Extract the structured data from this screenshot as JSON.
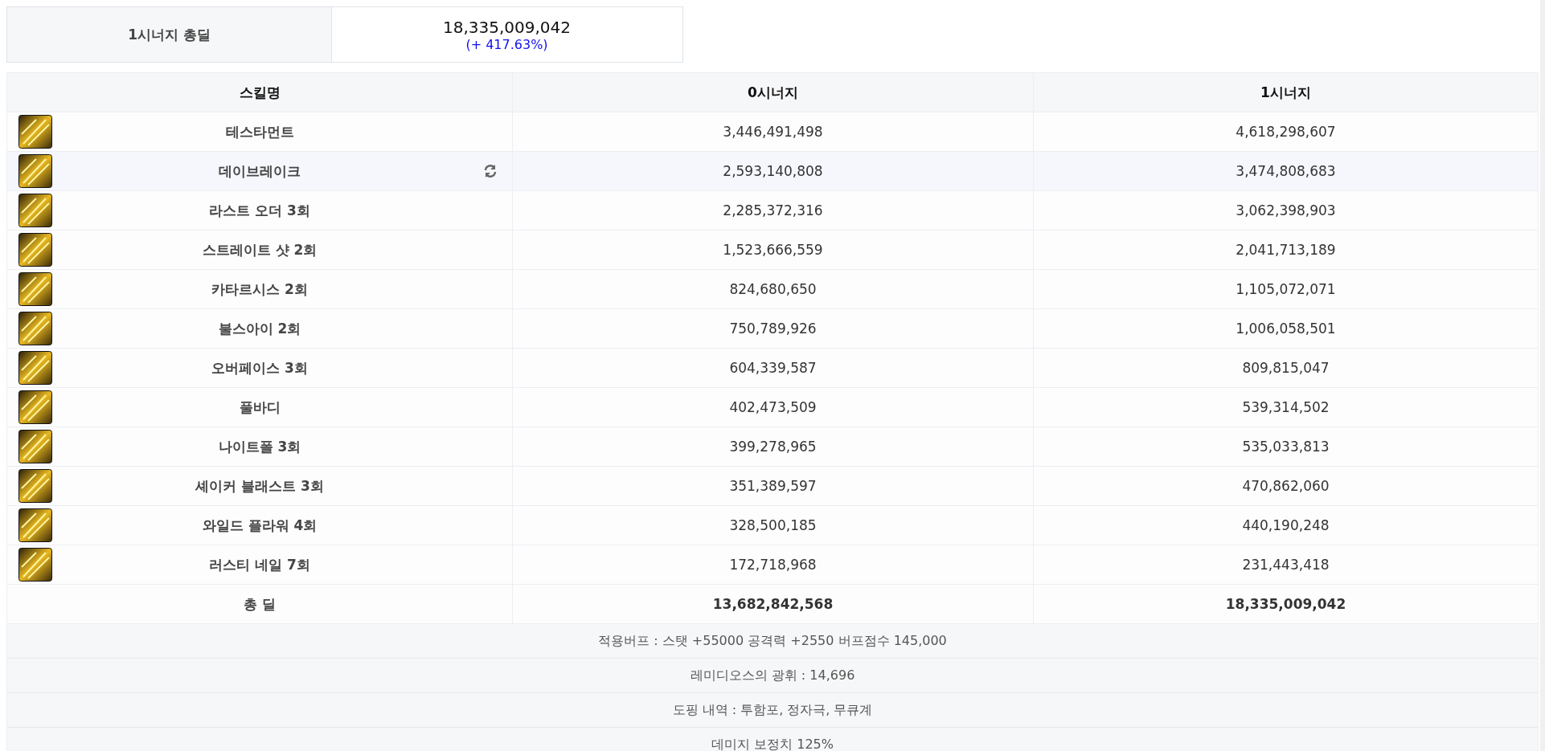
{
  "summary": {
    "label": "1시너지 총딜",
    "value": "18,335,009,042",
    "change": "(+ 417.63%)"
  },
  "table": {
    "columns": [
      "스킬명",
      "0시너지",
      "1시너지"
    ],
    "rows": [
      {
        "skill": "테스타먼트",
        "v0": "3,446,491,498",
        "v1": "4,618,298,607",
        "hovered": false
      },
      {
        "skill": "데이브레이크",
        "v0": "2,593,140,808",
        "v1": "3,474,808,683",
        "hovered": true
      },
      {
        "skill": "라스트 오더 3회",
        "v0": "2,285,372,316",
        "v1": "3,062,398,903",
        "hovered": false
      },
      {
        "skill": "스트레이트 샷 2회",
        "v0": "1,523,666,559",
        "v1": "2,041,713,189",
        "hovered": false
      },
      {
        "skill": "카타르시스 2회",
        "v0": "824,680,650",
        "v1": "1,105,072,071",
        "hovered": false
      },
      {
        "skill": "불스아이 2회",
        "v0": "750,789,926",
        "v1": "1,006,058,501",
        "hovered": false
      },
      {
        "skill": "오버페이스 3회",
        "v0": "604,339,587",
        "v1": "809,815,047",
        "hovered": false
      },
      {
        "skill": "풀바디",
        "v0": "402,473,509",
        "v1": "539,314,502",
        "hovered": false
      },
      {
        "skill": "나이트폴 3회",
        "v0": "399,278,965",
        "v1": "535,033,813",
        "hovered": false
      },
      {
        "skill": "셰이커 블래스트 3회",
        "v0": "351,389,597",
        "v1": "470,862,060",
        "hovered": false
      },
      {
        "skill": "와일드 플라워 4회",
        "v0": "328,500,185",
        "v1": "440,190,248",
        "hovered": false
      },
      {
        "skill": "러스티 네일 7회",
        "v0": "172,718,968",
        "v1": "231,443,418",
        "hovered": false
      }
    ],
    "total": {
      "label": "총 딜",
      "v0": "13,682,842,568",
      "v1": "18,335,009,042"
    },
    "notes": [
      "적용버프 : 스탯 +55000 공격력 +2550 버프점수 145,000",
      "레미디오스의 광휘 : 14,696",
      "도핑 내역 : 투함포, 정자극, 무큐계",
      "데미지 보정치 125%"
    ]
  }
}
